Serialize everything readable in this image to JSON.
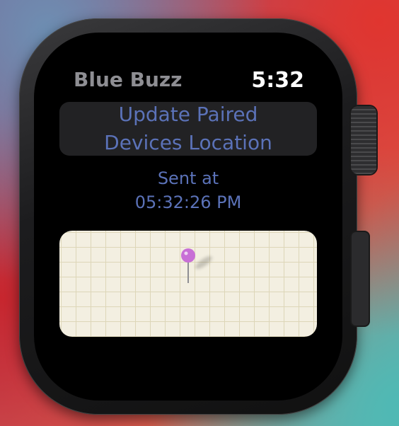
{
  "app": {
    "title": "Blue Buzz",
    "time": "5:32"
  },
  "update_button": {
    "label": "Update Paired\nDevices Location"
  },
  "status": {
    "sent_label": "Sent at",
    "sent_time": "05:32:26 PM"
  },
  "map": {
    "pin_color": "#c86fd6",
    "pin_icon": "map-pin-icon"
  },
  "colors": {
    "accent_text": "#5b72b8",
    "button_bg": "#222224",
    "map_bg": "#f3efe1"
  }
}
